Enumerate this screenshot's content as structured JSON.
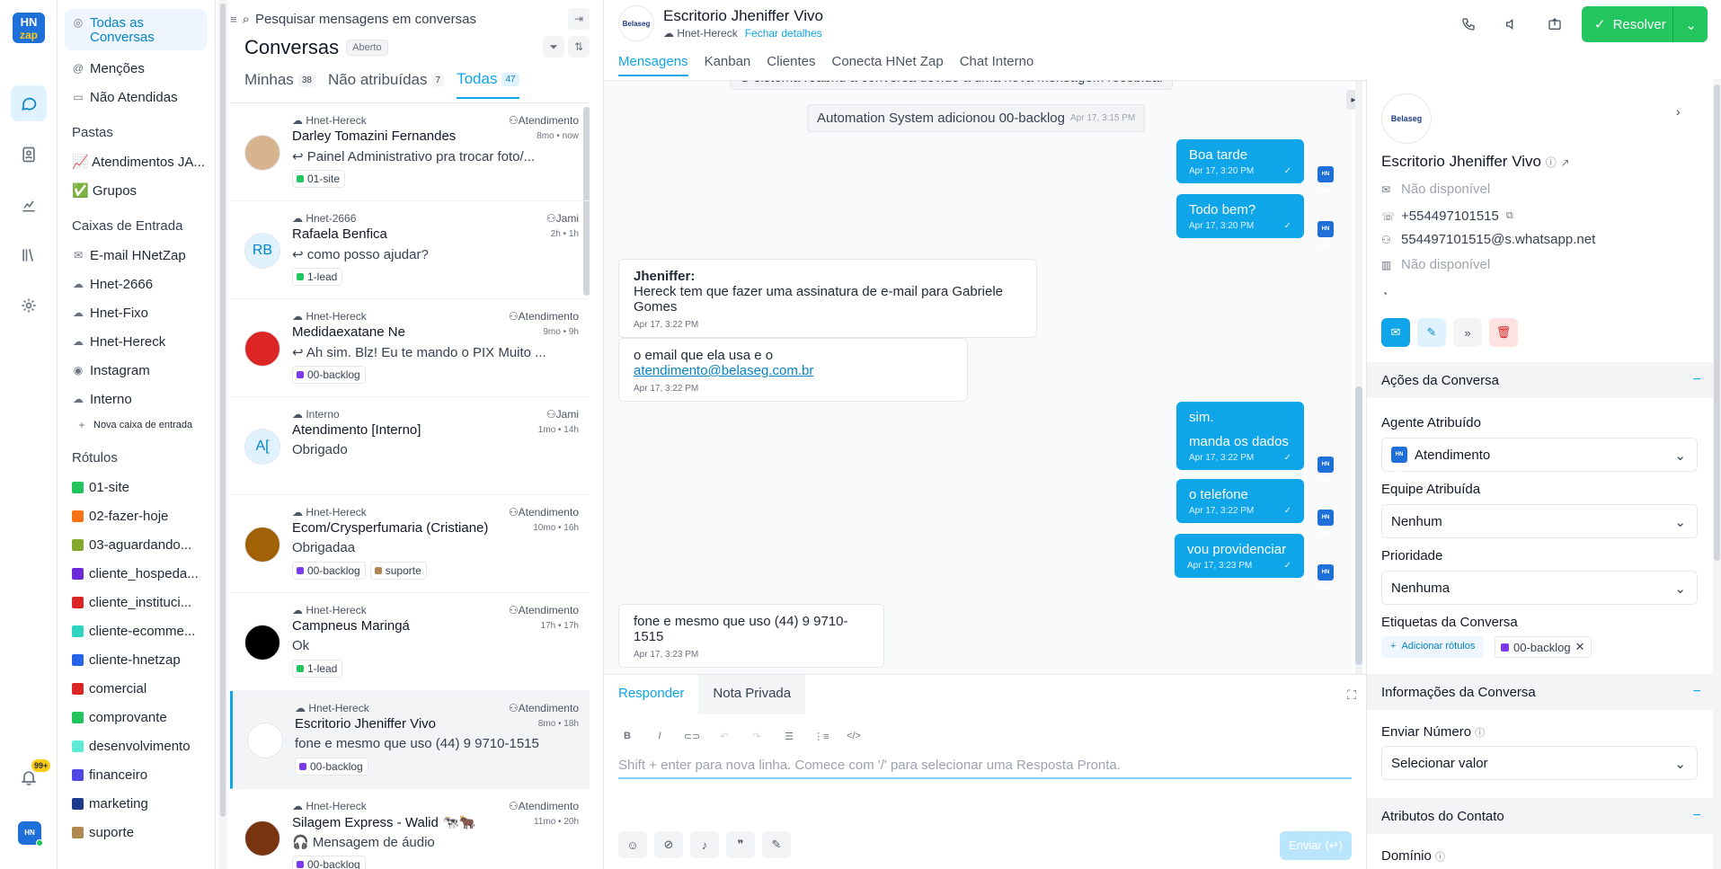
{
  "rail": {
    "logo_top": "HN",
    "logo_bottom": "zap",
    "notif_count": "99+",
    "avatar_label": "HN zap"
  },
  "sidebar": {
    "all_conversations": "Todas as Conversas",
    "mentions": "Menções",
    "unattended": "Não Atendidas",
    "folders_title": "Pastas",
    "folders": [
      {
        "label": "📈 Atendimentos JA..."
      },
      {
        "label": "✅ Grupos"
      }
    ],
    "inboxes_title": "Caixas de Entrada",
    "inboxes": [
      {
        "label": "E-mail HNetZap",
        "icon": "mail-icon"
      },
      {
        "label": "Hnet-2666",
        "icon": "cloud-icon"
      },
      {
        "label": "Hnet-Fixo",
        "icon": "cloud-icon"
      },
      {
        "label": "Hnet-Hereck",
        "icon": "cloud-icon"
      },
      {
        "label": "Instagram",
        "icon": "instagram-icon"
      },
      {
        "label": "Interno",
        "icon": "cloud-icon"
      }
    ],
    "new_inbox": "Nova caixa de entrada",
    "labels_title": "Rótulos",
    "labels": [
      {
        "label": "01-site",
        "color": "#22c55e"
      },
      {
        "label": "02-fazer-hoje",
        "color": "#f97316"
      },
      {
        "label": "03-aguardando...",
        "color": "#84a82e"
      },
      {
        "label": "cliente_hospeda...",
        "color": "#6d28d9"
      },
      {
        "label": "cliente_instituci...",
        "color": "#dc2626"
      },
      {
        "label": "cliente-ecomme...",
        "color": "#2dd4bf"
      },
      {
        "label": "cliente-hnetzap",
        "color": "#2563eb"
      },
      {
        "label": "comercial",
        "color": "#dc2626"
      },
      {
        "label": "comprovante",
        "color": "#22c55e"
      },
      {
        "label": "desenvolvimento",
        "color": "#5eead4"
      },
      {
        "label": "financeiro",
        "color": "#4f46e5"
      },
      {
        "label": "marketing",
        "color": "#1e3a8a"
      },
      {
        "label": "suporte",
        "color": "#b08850"
      }
    ]
  },
  "conversations": {
    "search_placeholder": "Pesquisar mensagens em conversas",
    "title": "Conversas",
    "status": "Aberto",
    "tabs": [
      {
        "label": "Minhas",
        "count": "38"
      },
      {
        "label": "Não atribuídas",
        "count": "7"
      },
      {
        "label": "Todas",
        "count": "47"
      }
    ],
    "items": [
      {
        "inbox": "Hnet-Hereck",
        "agent": "Atendimento",
        "name": "Darley Tomazini Fernandes",
        "time": "8mo • now",
        "msg": "↩ Painel Administrativo pra trocar foto/...",
        "labels": [
          {
            "text": "01-site",
            "color": "#22c55e"
          }
        ],
        "avatar": "",
        "avatar_bg": "#d6b48f"
      },
      {
        "inbox": "Hnet-2666",
        "agent": "Jami",
        "name": "Rafaela Benfica",
        "time": "2h • 1h",
        "msg": "↩ como posso ajudar?",
        "labels": [
          {
            "text": "1-lead",
            "color": "#22c55e"
          }
        ],
        "avatar": "RB",
        "avatar_bg": "#e0f2fe"
      },
      {
        "inbox": "Hnet-Hereck",
        "agent": "Atendimento",
        "name": "Medidaexatane Ne",
        "time": "9mo • 9h",
        "msg": "↩ Ah sim. Blz! Eu te mando o PIX Muito ...",
        "labels": [
          {
            "text": "00-backlog",
            "color": "#7c3aed"
          }
        ],
        "avatar": "",
        "avatar_bg": "#dc2626"
      },
      {
        "inbox": "Interno",
        "agent": "Jami",
        "name": "Atendimento [Interno]",
        "time": "1mo • 14h",
        "msg": "Obrigado",
        "labels": [],
        "avatar": "A[",
        "avatar_bg": "#e0f2fe"
      },
      {
        "inbox": "Hnet-Hereck",
        "agent": "Atendimento",
        "name": "Ecom/Crysperfumaria (Cristiane)",
        "time": "10mo • 16h",
        "msg": "Obrigadaa",
        "labels": [
          {
            "text": "00-backlog",
            "color": "#7c3aed"
          },
          {
            "text": "suporte",
            "color": "#b08850"
          }
        ],
        "avatar": "",
        "avatar_bg": "#a16207"
      },
      {
        "inbox": "Hnet-Hereck",
        "agent": "Atendimento",
        "name": "Campneus Maringá",
        "time": "17h • 17h",
        "msg": "Ok",
        "labels": [
          {
            "text": "1-lead",
            "color": "#22c55e"
          }
        ],
        "avatar": "",
        "avatar_bg": "#000000"
      },
      {
        "inbox": "Hnet-Hereck",
        "agent": "Atendimento",
        "name": "Escritorio Jheniffer Vivo",
        "time": "8mo • 18h",
        "msg": "fone e mesmo que uso (44) 9 9710-1515",
        "labels": [
          {
            "text": "00-backlog",
            "color": "#7c3aed"
          }
        ],
        "avatar": "",
        "avatar_bg": "#ffffff"
      },
      {
        "inbox": "Hnet-Hereck",
        "agent": "Atendimento",
        "name": "Silagem Express - Walid 🐄🐂",
        "time": "11mo • 20h",
        "msg": "🎧 Mensagem de áudio",
        "labels": [
          {
            "text": "00-backlog",
            "color": "#7c3aed"
          }
        ],
        "avatar": "",
        "avatar_bg": "#78350f"
      }
    ]
  },
  "header": {
    "name": "Escritorio Jheniffer Vivo",
    "inbox": "Hnet-Hereck",
    "close_details": "Fechar detalhes",
    "avatar_text": "Belaseg",
    "tabs": [
      "Mensagens",
      "Kanban",
      "Clientes",
      "Conecta HNet Zap",
      "Chat Interno"
    ],
    "resolve": "Resolver"
  },
  "chat": {
    "top_cut": "O sistema reabriu a conversa devido a uma nova mensagem recebida.",
    "system": {
      "text": "Automation System adicionou 00-backlog",
      "time": "Apr 17, 3:15 PM"
    },
    "out1": {
      "text": "Boa tarde",
      "time": "Apr 17, 3:20 PM"
    },
    "out2": {
      "text": "Todo bem?",
      "time": "Apr 17, 3:20 PM"
    },
    "in1": {
      "sender": "Jheniffer:",
      "text": "Hereck tem que fazer uma assinatura de e-mail para Gabriele Gomes",
      "time": "Apr 17, 3:22 PM"
    },
    "in2": {
      "text": "o email que ela usa e o ",
      "link": "atendimento@belaseg.com.br",
      "time": "Apr 17, 3:22 PM"
    },
    "out3": {
      "line1": "sim.",
      "line2": "manda os dados",
      "time": "Apr 17, 3:22 PM"
    },
    "out4": {
      "text": "o telefone",
      "time": "Apr 17, 3:22 PM"
    },
    "out5": {
      "text": "vou providenciar",
      "time": "Apr 17, 3:23 PM"
    },
    "in3": {
      "text": "fone e mesmo que uso (44) 9 9710-1515",
      "time": "Apr 17, 3:23 PM"
    },
    "bot_label": "HN zap"
  },
  "composer": {
    "tab_reply": "Responder",
    "tab_note": "Nota Privada",
    "placeholder": "Shift + enter para nova linha. Comece com '/' para selecionar uma Resposta Pronta.",
    "send": "Enviar (↵)"
  },
  "contact": {
    "avatar_text": "Belaseg",
    "name": "Escritorio Jheniffer Vivo",
    "email": "Não disponível",
    "phone": "+554497101515",
    "whatsapp_id": "554497101515@s.whatsapp.net",
    "company": "Não disponível",
    "actions_title": "Ações da Conversa",
    "agent_label": "Agente Atribuído",
    "agent_value": "Atendimento",
    "team_label": "Equipe Atribuída",
    "team_value": "Nenhum",
    "priority_label": "Prioridade",
    "priority_value": "Nenhuma",
    "tags_label": "Etiquetas da Conversa",
    "add_tags": "Adicionar rótulos",
    "tag": "00-backlog",
    "info_title": "Informações da Conversa",
    "send_number_label": "Enviar Número",
    "send_number_value": "Selecionar valor",
    "attrs_title": "Atributos do Contato",
    "domain_label": "Domínio"
  }
}
